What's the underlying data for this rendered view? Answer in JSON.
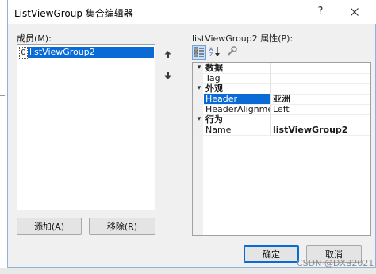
{
  "window": {
    "title": "ListViewGroup 集合编辑器",
    "help_label": "?"
  },
  "members": {
    "label": "成员(M):",
    "items": [
      {
        "index": "0",
        "label": "listViewGroup2",
        "selected": true
      }
    ]
  },
  "buttons": {
    "add": "添加(A)",
    "remove": "移除(R)",
    "ok": "确定",
    "cancel": "取消"
  },
  "properties": {
    "label": "listViewGroup2 属性(P):",
    "categories": [
      {
        "name": "数据",
        "rows": [
          {
            "name": "Tag",
            "value": ""
          }
        ]
      },
      {
        "name": "外观",
        "rows": [
          {
            "name": "Header",
            "value": "亚洲",
            "selected": true
          },
          {
            "name": "HeaderAlignment",
            "value": "Left"
          }
        ]
      },
      {
        "name": "行为",
        "rows": [
          {
            "name": "Name",
            "value": "listViewGroup2"
          }
        ]
      }
    ]
  },
  "icons": {
    "move_up": "arrow-up-icon",
    "move_down": "arrow-down-icon",
    "categorized": "categorized-icon",
    "alphabetical": "alphabetical-icon",
    "property_pages": "wrench-icon",
    "close": "close-icon",
    "caret": "collapse-caret-icon"
  },
  "colors": {
    "selection": "#0a6ad6",
    "dialog_background": "#f0f0f0"
  },
  "watermark": "CSDN @DXB2021"
}
